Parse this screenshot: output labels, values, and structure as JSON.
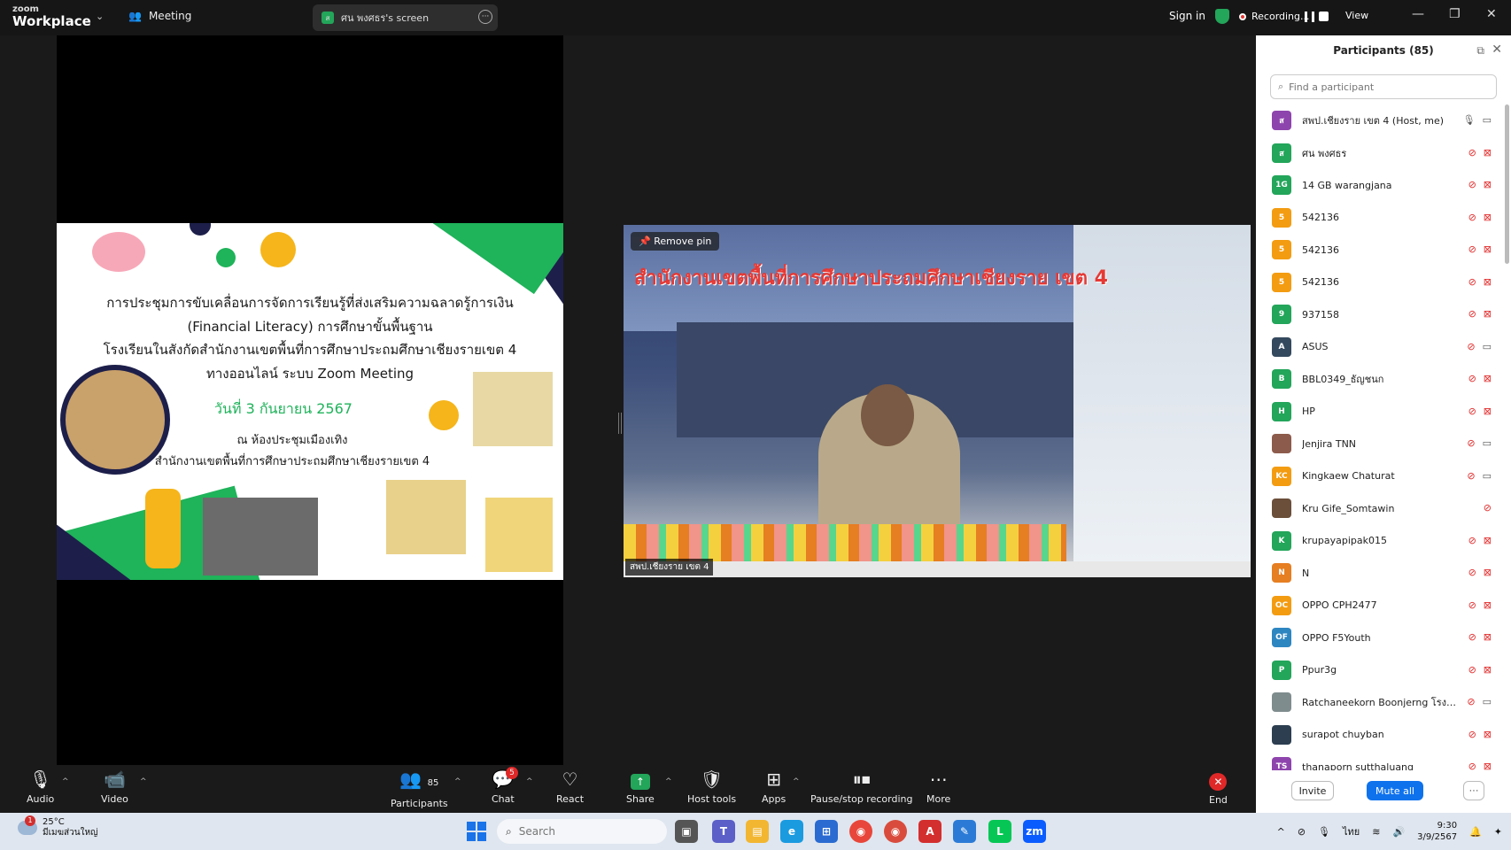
{
  "app": {
    "logo_small": "zoom",
    "logo_big": "Workplace",
    "meeting_tab": "Meeting",
    "screen_tab": "ศน พงศธร's screen"
  },
  "topbar": {
    "signin": "Sign in",
    "recording": "Recording...",
    "view": "View"
  },
  "slide": {
    "line1": "การประชุมการขับเคลื่อนการจัดการเรียนรู้ที่ส่งเสริมความฉลาดรู้การเงิน",
    "line2": "(Financial Literacy) การศึกษาขั้นพื้นฐาน",
    "line3": "โรงเรียนในสังกัดสำนักงานเขตพื้นที่การศึกษาประถมศึกษาเชียงรายเขต 4",
    "line4": "ทางออนไลน์ ระบบ Zoom Meeting",
    "date": "วันที่ 3 กันยายน 2567",
    "venue1": "ณ ห้องประชุมเมืองเทิง",
    "venue2": "สำนักงานเขตพื้นที่การศึกษาประถมศึกษาเชียงรายเขต 4"
  },
  "video": {
    "banner": "สำนักงานเขตพื้นที่การศึกษาประถมศึกษาเชียงราย เขต 4",
    "remove_pin": "Remove pin",
    "name": "สพป.เชียงราย เขต 4"
  },
  "toolbar": {
    "audio": "Audio",
    "video": "Video",
    "participants": "Participants",
    "participants_count": "85",
    "chat": "Chat",
    "chat_badge": "5",
    "react": "React",
    "share": "Share",
    "host_tools": "Host tools",
    "apps": "Apps",
    "pause_stop": "Pause/stop recording",
    "more": "More",
    "end": "End"
  },
  "panel": {
    "title": "Participants (85)",
    "search_placeholder": "Find a participant",
    "invite": "Invite",
    "mute_all": "Mute all",
    "participants": [
      {
        "initials": "ส",
        "color": "#8e44ad",
        "name": "สพป.เชียงราย เขต 4 (Host, me)",
        "mic": "on",
        "cam": "on"
      },
      {
        "initials": "ส",
        "color": "#23a55a",
        "name": "ศน พงศธร",
        "mic": "muted",
        "cam": "off"
      },
      {
        "initials": "1G",
        "color": "#23a55a",
        "name": "14 GB warangjana",
        "mic": "muted",
        "cam": "off"
      },
      {
        "initials": "5",
        "color": "#f39c12",
        "name": "542136",
        "mic": "muted",
        "cam": "off"
      },
      {
        "initials": "5",
        "color": "#f39c12",
        "name": "542136",
        "mic": "muted",
        "cam": "off"
      },
      {
        "initials": "5",
        "color": "#f39c12",
        "name": "542136",
        "mic": "muted",
        "cam": "off"
      },
      {
        "initials": "9",
        "color": "#23a55a",
        "name": "937158",
        "mic": "muted",
        "cam": "off"
      },
      {
        "initials": "A",
        "color": "#34495e",
        "name": "ASUS",
        "mic": "muted",
        "cam": "on"
      },
      {
        "initials": "B",
        "color": "#23a55a",
        "name": "BBL0349_ธัญชนก",
        "mic": "muted",
        "cam": "off"
      },
      {
        "initials": "H",
        "color": "#23a55a",
        "name": "HP",
        "mic": "muted",
        "cam": "off"
      },
      {
        "initials": "",
        "color": "#8d5b4c",
        "name": "Jenjira TNN",
        "mic": "muted",
        "cam": "on"
      },
      {
        "initials": "KC",
        "color": "#f39c12",
        "name": "Kingkaew Chaturat",
        "mic": "muted",
        "cam": "on"
      },
      {
        "initials": "",
        "color": "#6b4f3a",
        "name": "Kru Gife_Somtawin",
        "mic": "muted",
        "cam": ""
      },
      {
        "initials": "K",
        "color": "#23a55a",
        "name": "krupayapipak015",
        "mic": "muted",
        "cam": "off"
      },
      {
        "initials": "N",
        "color": "#e67e22",
        "name": "N",
        "mic": "muted",
        "cam": "off"
      },
      {
        "initials": "OC",
        "color": "#f39c12",
        "name": "OPPO CPH2477",
        "mic": "muted",
        "cam": "off"
      },
      {
        "initials": "OF",
        "color": "#2e86c1",
        "name": "OPPO F5Youth",
        "mic": "muted",
        "cam": "off"
      },
      {
        "initials": "P",
        "color": "#23a55a",
        "name": "Ppur3g",
        "mic": "muted",
        "cam": "off"
      },
      {
        "initials": "",
        "color": "#7f8c8d",
        "name": "Ratchaneekorn Boonjerng โรงเรีย...",
        "mic": "muted",
        "cam": "on"
      },
      {
        "initials": "",
        "color": "#2c3e50",
        "name": "surapot chuyban",
        "mic": "muted",
        "cam": "off"
      },
      {
        "initials": "TS",
        "color": "#8e44ad",
        "name": "thanaporn sutthaluang",
        "mic": "muted",
        "cam": "off"
      }
    ]
  },
  "taskbar": {
    "temp": "25°C",
    "weather_desc": "มีเมฆส่วนใหญ่",
    "weather_badge": "1",
    "search": "Search",
    "lang": "ไทย",
    "time": "9:30",
    "date": "3/9/2567"
  }
}
